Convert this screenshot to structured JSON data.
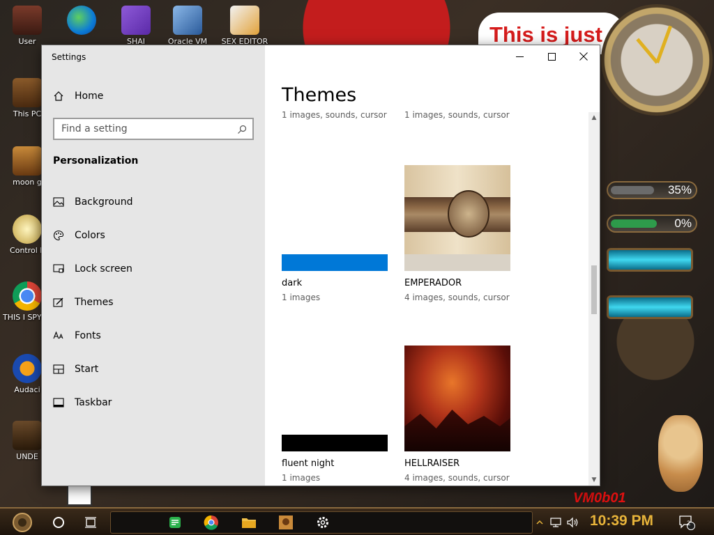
{
  "desktop": {
    "icons": [
      {
        "label": "User"
      },
      {
        "label": "SHAI"
      },
      {
        "label": "Oracle VM"
      },
      {
        "label": "SEX EDITOR"
      },
      {
        "label": "This PC"
      },
      {
        "label": "moon g"
      },
      {
        "label": "Control P"
      },
      {
        "label": "THIS I SPYWA"
      },
      {
        "label": "Audaci"
      },
      {
        "label": "UNDE"
      }
    ],
    "banner_text": "This is just",
    "meters": [
      {
        "pct_label": "35%",
        "fill": 0.35,
        "color": "#6b6b6b"
      },
      {
        "pct_label": "0%",
        "fill": 0.6,
        "color": "#2e9b4b"
      }
    ],
    "watermark": "VM0b01"
  },
  "window": {
    "app_title": "Settings",
    "home_label": "Home",
    "search_placeholder": "Find a setting",
    "section_title": "Personalization",
    "nav_items": [
      {
        "label": "Background",
        "icon": "picture-icon"
      },
      {
        "label": "Colors",
        "icon": "palette-icon"
      },
      {
        "label": "Lock screen",
        "icon": "lock-screen-icon"
      },
      {
        "label": "Themes",
        "icon": "brush-icon"
      },
      {
        "label": "Fonts",
        "icon": "fonts-icon"
      },
      {
        "label": "Start",
        "icon": "start-icon"
      },
      {
        "label": "Taskbar",
        "icon": "taskbar-icon"
      }
    ],
    "page_title": "Themes",
    "top_descs": [
      "1 images, sounds, cursor",
      "1 images, sounds, cursor"
    ],
    "themes": [
      {
        "name": "dark",
        "desc": "1 images",
        "swatch": "#0078d7"
      },
      {
        "name": "EMPERADOR",
        "desc": "4 images, sounds, cursor"
      },
      {
        "name": "fluent night",
        "desc": "1 images",
        "swatch": "#000000"
      },
      {
        "name": "HELLRAISER",
        "desc": "4 images, sounds, cursor"
      }
    ]
  },
  "tray": {
    "time": "10:39 PM",
    "notifications": "2"
  },
  "colors": {
    "accent": "#0078d7",
    "clock_text": "#e8b43a"
  }
}
